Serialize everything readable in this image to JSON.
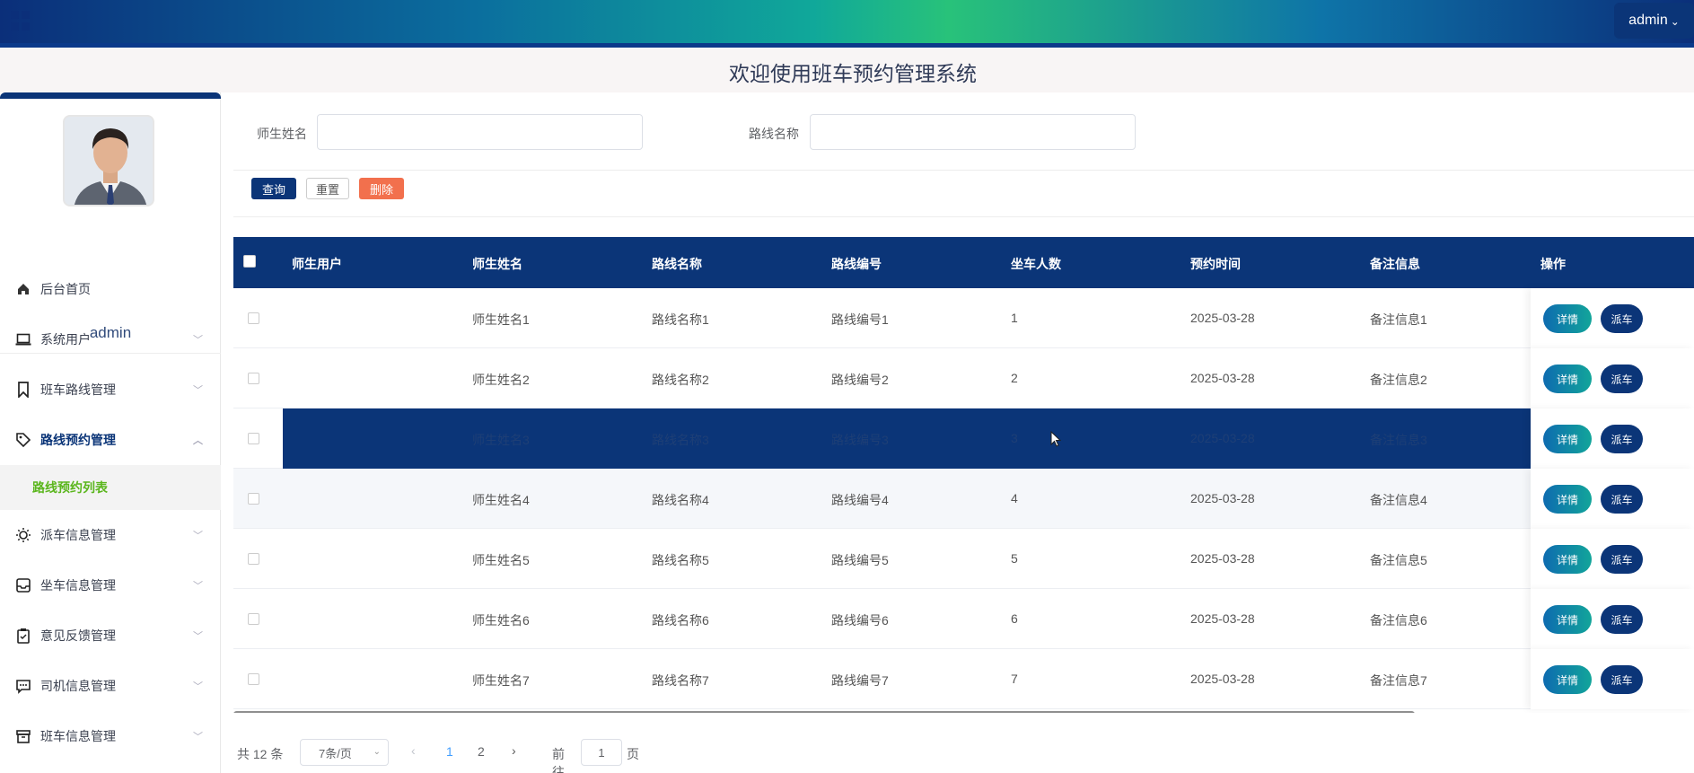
{
  "header": {
    "user_label": "admin",
    "colors": {
      "brand": "#0b3578",
      "accent_green": "#5bb61d",
      "delete": "#f2704d"
    }
  },
  "page_title": "欢迎使用班车预约管理系统",
  "sidebar": {
    "username": "admin",
    "items": [
      {
        "label": "后台首页",
        "icon": "home-icon"
      },
      {
        "label": "系统用户",
        "icon": "laptop-icon"
      },
      {
        "label": "班车路线管理",
        "icon": "bookmark-icon"
      },
      {
        "label": "路线预约管理",
        "icon": "tag-icon"
      },
      {
        "label": "派车信息管理",
        "icon": "sun-icon"
      },
      {
        "label": "坐车信息管理",
        "icon": "inbox-icon"
      },
      {
        "label": "意见反馈管理",
        "icon": "clipboard-icon"
      },
      {
        "label": "司机信息管理",
        "icon": "chat-icon"
      },
      {
        "label": "班车信息管理",
        "icon": "archive-icon"
      }
    ],
    "submenu_active": "路线预约列表"
  },
  "search": {
    "teacher_name_label": "师生姓名",
    "teacher_name_value": "",
    "route_name_label": "路线名称",
    "route_name_value": "",
    "query_label": "查询",
    "reset_label": "重置",
    "delete_label": "删除"
  },
  "table": {
    "columns": [
      "师生用户",
      "师生姓名",
      "路线名称",
      "路线编号",
      "坐车人数",
      "预约时间",
      "备注信息",
      "操作"
    ],
    "detail_label": "详情",
    "dispatch_label": "派车",
    "rows": [
      {
        "user": "",
        "name": "师生姓名1",
        "route": "路线名称1",
        "code": "路线编号1",
        "count": "1",
        "time": "2025-03-28",
        "note": "备注信息1"
      },
      {
        "user": "",
        "name": "师生姓名2",
        "route": "路线名称2",
        "code": "路线编号2",
        "count": "2",
        "time": "2025-03-28",
        "note": "备注信息2"
      },
      {
        "user": "",
        "name": "师生姓名3",
        "route": "路线名称3",
        "code": "路线编号3",
        "count": "3",
        "time": "2025-03-28",
        "note": "备注信息3"
      },
      {
        "user": "",
        "name": "师生姓名4",
        "route": "路线名称4",
        "code": "路线编号4",
        "count": "4",
        "time": "2025-03-28",
        "note": "备注信息4"
      },
      {
        "user": "",
        "name": "师生姓名5",
        "route": "路线名称5",
        "code": "路线编号5",
        "count": "5",
        "time": "2025-03-28",
        "note": "备注信息5"
      },
      {
        "user": "",
        "name": "师生姓名6",
        "route": "路线名称6",
        "code": "路线编号6",
        "count": "6",
        "time": "2025-03-28",
        "note": "备注信息6"
      },
      {
        "user": "",
        "name": "师生姓名7",
        "route": "路线名称7",
        "code": "路线编号7",
        "count": "7",
        "time": "2025-03-28",
        "note": "备注信息7"
      }
    ]
  },
  "pagination": {
    "total_text": "共 12 条",
    "page_size": "7条/页",
    "pages": [
      "1",
      "2"
    ],
    "current_page": "1",
    "goto_label": "前往",
    "goto_value": "1",
    "page_suffix": "页"
  }
}
